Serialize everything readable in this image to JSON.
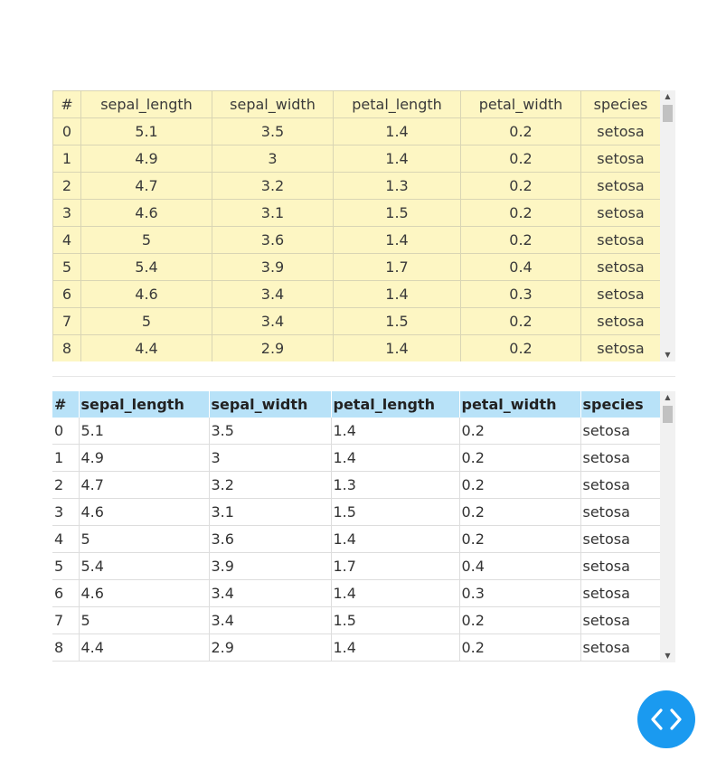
{
  "tables": {
    "columns": [
      "#",
      "sepal_length",
      "sepal_width",
      "petal_length",
      "petal_width",
      "species"
    ],
    "rows": [
      [
        "0",
        "5.1",
        "3.5",
        "1.4",
        "0.2",
        "setosa"
      ],
      [
        "1",
        "4.9",
        "3",
        "1.4",
        "0.2",
        "setosa"
      ],
      [
        "2",
        "4.7",
        "3.2",
        "1.3",
        "0.2",
        "setosa"
      ],
      [
        "3",
        "4.6",
        "3.1",
        "1.5",
        "0.2",
        "setosa"
      ],
      [
        "4",
        "5",
        "3.6",
        "1.4",
        "0.2",
        "setosa"
      ],
      [
        "5",
        "5.4",
        "3.9",
        "1.7",
        "0.4",
        "setosa"
      ],
      [
        "6",
        "4.6",
        "3.4",
        "1.4",
        "0.3",
        "setosa"
      ],
      [
        "7",
        "5",
        "3.4",
        "1.5",
        "0.2",
        "setosa"
      ],
      [
        "8",
        "4.4",
        "2.9",
        "1.4",
        "0.2",
        "setosa"
      ]
    ]
  },
  "colors": {
    "table1_cell_bg": "#fdf6c3",
    "table2_header_bg": "#b8e2f8",
    "code_button_bg": "#1a9af0"
  },
  "icons": {
    "code_button": "code-brackets-icon",
    "scroll_up": "triangle-up-icon",
    "scroll_down": "triangle-down-icon"
  }
}
